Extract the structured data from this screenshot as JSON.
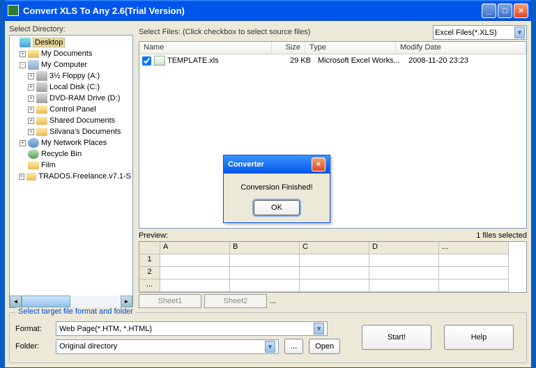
{
  "window": {
    "title": "Convert XLS To Any 2.6(Trial Version)"
  },
  "left": {
    "label": "Select Directory:",
    "tree": [
      {
        "indent": 0,
        "exp": "",
        "icon": "desktop",
        "label": "Desktop",
        "sel": true
      },
      {
        "indent": 1,
        "exp": "+",
        "icon": "folder",
        "label": "My Documents"
      },
      {
        "indent": 1,
        "exp": "-",
        "icon": "computer",
        "label": "My Computer"
      },
      {
        "indent": 2,
        "exp": "+",
        "icon": "drive",
        "label": "3½ Floppy (A:)"
      },
      {
        "indent": 2,
        "exp": "+",
        "icon": "drive",
        "label": "Local Disk (C:)"
      },
      {
        "indent": 2,
        "exp": "+",
        "icon": "drive",
        "label": "DVD-RAM Drive (D:)"
      },
      {
        "indent": 2,
        "exp": "+",
        "icon": "folder",
        "label": "Control Panel"
      },
      {
        "indent": 2,
        "exp": "+",
        "icon": "folder",
        "label": "Shared Documents"
      },
      {
        "indent": 2,
        "exp": "+",
        "icon": "folder",
        "label": "Silvana's Documents"
      },
      {
        "indent": 1,
        "exp": "+",
        "icon": "network",
        "label": "My Network Places"
      },
      {
        "indent": 1,
        "exp": "",
        "icon": "recycle",
        "label": "Recycle Bin"
      },
      {
        "indent": 1,
        "exp": "",
        "icon": "folder",
        "label": "Film"
      },
      {
        "indent": 1,
        "exp": "+",
        "icon": "folder",
        "label": "TRADOS.Freelance.v7.1-S"
      }
    ]
  },
  "right": {
    "label": "Select Files: (Click checkbox to select source files)",
    "filter": "Excel Files(*.XLS)",
    "cols": {
      "name": "Name",
      "size": "Size",
      "type": "Type",
      "mod": "Modify Date"
    },
    "rows": [
      {
        "checked": true,
        "name": "TEMPLATE.xls",
        "size": "29 KB",
        "type": "Microsoft Excel Works...",
        "mod": "2008-11-20 23:23"
      }
    ],
    "preview_label": "Preview:",
    "selected_text": "1 files selected",
    "grid_cols": [
      "A",
      "B",
      "C",
      "D",
      "..."
    ],
    "grid_rows": [
      "1",
      "2",
      "..."
    ],
    "sheets": [
      "Sheet1",
      "Sheet2"
    ],
    "sheets_more": "..."
  },
  "lower": {
    "title": "Select target file format and folder",
    "format_label": "Format:",
    "format_value": "Web Page(*.HTM, *.HTML)",
    "folder_label": "Folder:",
    "folder_value": "Original directory",
    "browse": "...",
    "open": "Open",
    "start": "Start!",
    "help": "Help"
  },
  "dialog": {
    "title": "Converter",
    "message": "Conversion Finished!",
    "ok": "OK"
  }
}
